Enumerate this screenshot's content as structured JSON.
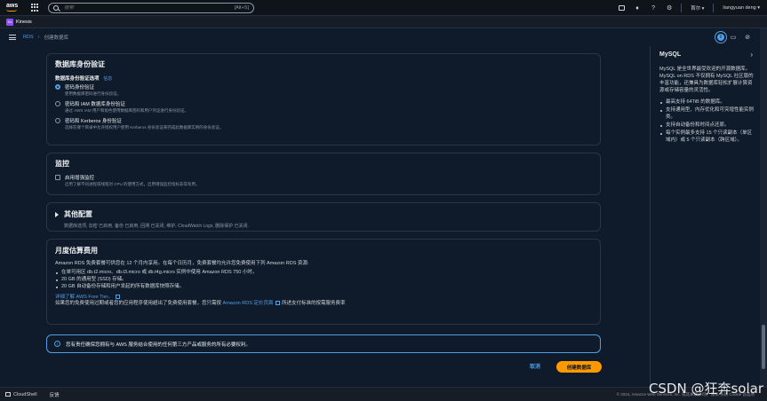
{
  "topbar": {
    "logo": "aws",
    "search_placeholder": "搜索",
    "search_shortcut": "[Alt+S]",
    "region": "首尔",
    "user": "liangyuan deng"
  },
  "service": {
    "badge": "Ks",
    "name": "Kinesis"
  },
  "breadcrumb": {
    "root": "RDS",
    "current": "创建数据库"
  },
  "auth": {
    "title": "数据库身份验证",
    "options_label": "数据库身份验证选项",
    "info": "信息",
    "options": [
      {
        "title": "密码身份验证",
        "desc": "使用数据库密码进行身份验证。",
        "selected": true
      },
      {
        "title": "密码和 IAM 数据库身份验证",
        "desc": "通过 AWS IAM 用户和角色使用数据库密码和用户凭证进行身份验证。",
        "selected": false
      },
      {
        "title": "密码和 Kerberos 身份验证",
        "desc": "选择在哪个目录中允许授权用户使用 Kerberos 身份验证来完成此数据库实例的身份验证。",
        "selected": false
      }
    ]
  },
  "monitoring": {
    "title": "监控",
    "option_title": "启用增强监控",
    "option_desc": "启用了解不同进程或线程对 CPU 的使用方式，启用增强监控指标非常有用。"
  },
  "additional": {
    "title": "其他配置",
    "summary": "数据库选项, 加密 已启用, 备份 已启用, 回溯 已关闭, 维护, CloudWatch Logs, 删除保护 已关闭."
  },
  "cost": {
    "title": "月度估算费用",
    "intro": "Amazon RDS 免费套餐可供您在 12 个月内享用。在每个日历月，免费套餐均允许您免费使用下列 Amazon RDS 资源:",
    "bullets": [
      "在单可用区 db.t2.micro、db.t3.micro 或 db.t4g.micro 实例中使用 Amazon RDS 750 小时。",
      "20 GB 的通用型 (SSD) 存储。",
      "20 GB 自动备份存储和用户发起的所有数据库快照存储。"
    ],
    "free_tier_link": "详细了解 AWS Free Tier。",
    "outro_prefix": "如果您的免费使用过期或者您的应用程序使用超出了免费使用套餐，您只需按",
    "pricing_link": "Amazon RDS 定价页面",
    "outro_suffix": "所述支付标准的按需服务费率"
  },
  "alert": {
    "text": "您有责任确保您拥有与 AWS 服务结合使用的任何第三方产品或服务的所有必要权利。"
  },
  "actions": {
    "cancel": "取消",
    "create": "创建数据库"
  },
  "help": {
    "title": "MySQL",
    "intro": "MySQL 是全世界最受欢迎的开源数据库。MySQL on RDS 不仅拥有 MySQL 社区版的丰富功能，还兼具为数据库轻松扩展计算资源或存储容量的灵活性。",
    "bullets": [
      "最高支持 64TiB 的数据库。",
      "支持通用型、内存优化和可突增性能实例类。",
      "支持自动备份和时间点还原。",
      "每个实例最多支持 15 个只读副本（单区域内）或 5 个只读副本（跨区域）。"
    ]
  },
  "footer": {
    "cloudshell": "CloudShell",
    "feedback": "反馈",
    "copyright": "© 2024, Amazon Web Services, Inc. 或其关联公司。  隐私  条款  Cookie 首选项"
  },
  "watermark": "CSDN @狂奔solar",
  "colors": {
    "accent": "#539fe5",
    "primary_button": "#ff9900",
    "background": "#0f1b2a"
  }
}
